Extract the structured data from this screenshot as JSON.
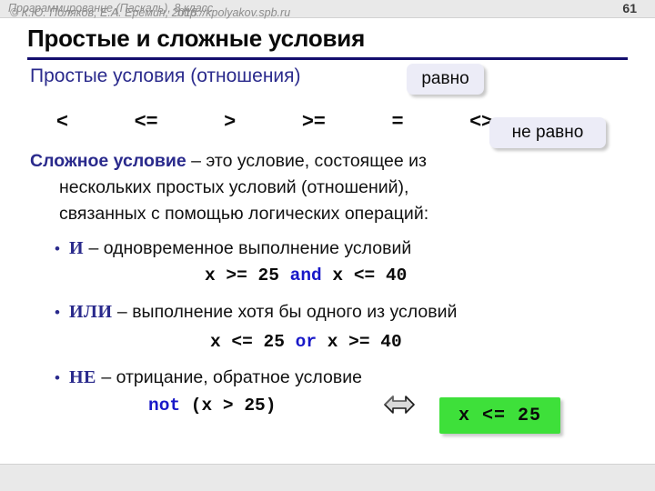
{
  "header": {
    "course_title": "Программирование (Паскаль), 8 класс",
    "page_number": "61"
  },
  "slide": {
    "title": "Простые и сложные условия",
    "rule_color": "#140f6e",
    "accent_color": "#2a2a8c"
  },
  "simple_conditions": {
    "heading": "Простые условия (отношения)",
    "operators": [
      "<",
      "<=",
      ">",
      ">=",
      "=",
      "<>"
    ],
    "callouts": {
      "equal": "равно",
      "not_equal": "не равно",
      "chip_bg": "#ececf7"
    }
  },
  "complex_condition": {
    "term": "Сложное условие",
    "line1": " – это условие, состоящее из",
    "line2": "нескольких простых условий (отношений),",
    "line3": "связанных с помощью логических операций:"
  },
  "bullets": [
    {
      "dot": "•",
      "keyword": "И",
      "description": " – одновременное выполнение условий",
      "code_prefix": "x >= 25 ",
      "code_operator": "and",
      "code_suffix": " x <= 40"
    },
    {
      "dot": "•",
      "keyword": "ИЛИ",
      "description": " – выполнение хотя бы одного из условий",
      "code_prefix": "x <= 25 ",
      "code_operator": "or",
      "code_suffix": " x >= 40"
    },
    {
      "dot": "•",
      "keyword": "НЕ",
      "description": " – отрицание, обратное условие",
      "code_operator": "not",
      "code_suffix": " (x > 25)"
    }
  ],
  "equivalence": {
    "arrow_icon": "double-headed-arrow",
    "result": "x <= 25",
    "result_bg": "#3ee03a"
  },
  "footer": {
    "copyright": "© К.Ю. Поляков, Е.А. Ерёмин, 2018",
    "url": "http://kpolyakov.spb.ru"
  }
}
